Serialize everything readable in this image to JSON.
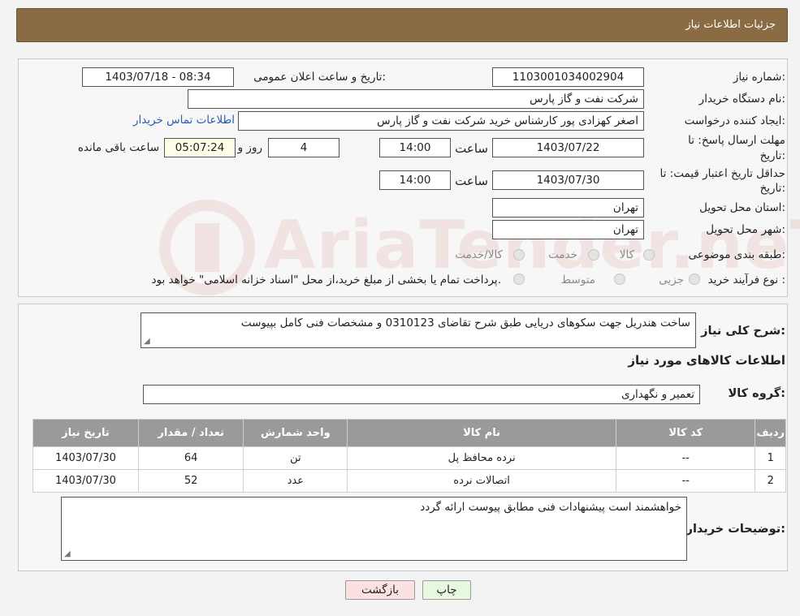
{
  "header": {
    "title": "جزئیات اطلاعات نیاز"
  },
  "watermark": {
    "text": "AriaTender.neT"
  },
  "info": {
    "need_number_label": "شماره نیاز:",
    "need_number": "1103001034002904",
    "announce_label": "تاریخ و ساعت اعلان عمومی:",
    "announce_value": "1403/07/18 - 08:34",
    "buyer_org_label": "نام دستگاه خریدار:",
    "buyer_org": "شرکت نفت و گاز پارس",
    "creator_label": "ایجاد کننده درخواست:",
    "creator": "اصغر کهزادی پور کارشناس خرید شرکت نفت و گاز پارس",
    "contact_link": "اطلاعات تماس خریدار",
    "deadline_label_1": "مهلت ارسال پاسخ: تا",
    "deadline_label_2": "تاریخ:",
    "deadline_date": "1403/07/22",
    "time_label": "ساعت",
    "deadline_time": "14:00",
    "days_value": "4",
    "days_label": "روز و",
    "remaining_value": "05:07:24",
    "remaining_label": "ساعت باقی مانده",
    "validity_label_1": "حداقل تاریخ اعتبار قیمت: تا",
    "validity_label_2": "تاریخ:",
    "validity_date": "1403/07/30",
    "validity_time_label": "ساعت",
    "validity_time": "14:00",
    "province_label": "استان محل تحویل:",
    "province": "تهران",
    "city_label": "شهر محل تحویل:",
    "city": "تهران",
    "category_label": "طبقه بندی موضوعی:",
    "category_options": [
      "کالا",
      "خدمت",
      "کالا/خدمت"
    ],
    "process_label": "نوع فرآیند خرید :",
    "process_options": [
      "جزیی",
      "متوسط"
    ],
    "process_note": "پرداخت تمام یا بخشی از مبلغ خرید،از محل \"اسناد خزانه اسلامی\" خواهد بود."
  },
  "details": {
    "summary_label": "شرح کلی نیاز:",
    "summary": "ساخت هندریل جهت سکوهای دریایی  طبق شرح  تقاضای 0310123 و مشخصات فنی کامل بپیوست",
    "goods_title": "اطلاعات کالاهای مورد نیاز",
    "group_label": "گروه کالا:",
    "group_value": "تعمیر و نگهداری",
    "table": {
      "headers": [
        "ردیف",
        "کد کالا",
        "نام کالا",
        "واحد شمارش",
        "تعداد / مقدار",
        "تاریخ نیاز"
      ],
      "rows": [
        [
          "1",
          "--",
          "نرده محافظ پل",
          "تن",
          "64",
          "1403/07/30"
        ],
        [
          "2",
          "--",
          "اتصالات نرده",
          "عدد",
          "52",
          "1403/07/30"
        ]
      ]
    },
    "buyer_notes_label": "توضیحات خریدار:",
    "buyer_notes": "خواهشمند است پیشنهادات فنی مطابق پیوست ارائه گردد"
  },
  "buttons": {
    "print": "چاپ",
    "back": "بازگشت"
  },
  "colors": {
    "header_bg": "#8b6b43",
    "table_header_bg": "#9a9a9a",
    "print_bg": "#e8f8e0",
    "back_bg": "#fbe1e1"
  }
}
